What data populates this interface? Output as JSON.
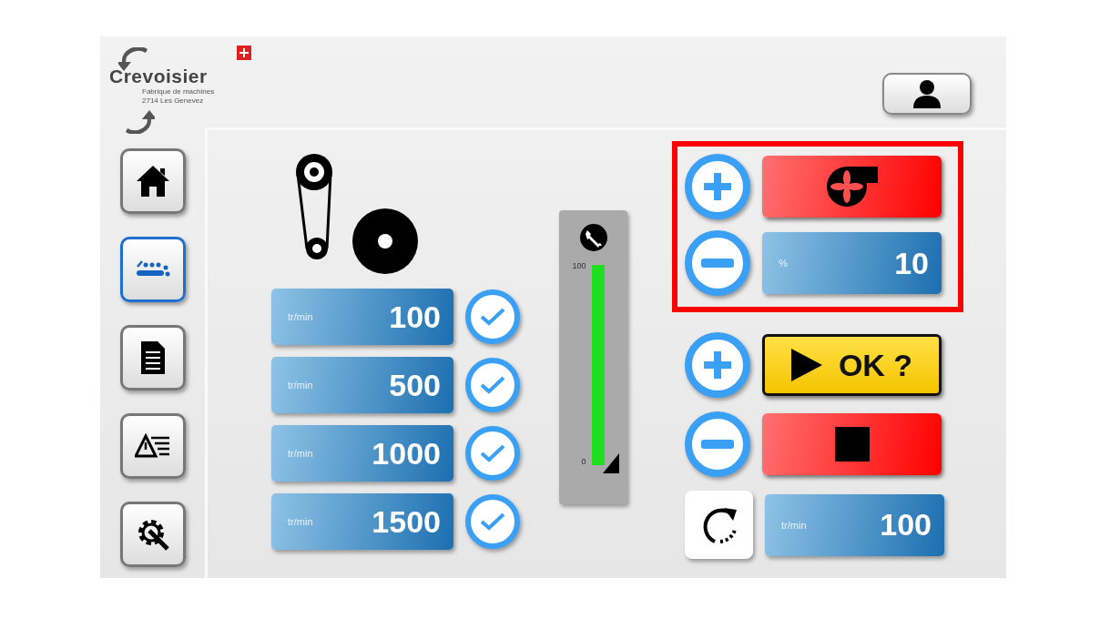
{
  "logo": {
    "name": "Crevoisier",
    "subtitle": [
      "Fabrique de machines",
      "2714 Les Genevez"
    ]
  },
  "sidebar": {
    "items": [
      {
        "kind": "home",
        "selected": false
      },
      {
        "kind": "conveyor",
        "selected": true
      },
      {
        "kind": "document",
        "selected": false
      },
      {
        "kind": "alarms",
        "selected": false
      },
      {
        "kind": "settings",
        "selected": false
      }
    ]
  },
  "speed_presets": [
    {
      "unit": "tr/min",
      "value": "100",
      "checked": true
    },
    {
      "unit": "tr/min",
      "value": "500",
      "checked": true
    },
    {
      "unit": "tr/min",
      "value": "1000",
      "checked": true
    },
    {
      "unit": "tr/min",
      "value": "1500",
      "checked": true
    }
  ],
  "gauge": {
    "max_label": "100",
    "min_label": "0",
    "level": 1
  },
  "fan_panel": {
    "highlighted": true,
    "on": false,
    "unit": "%",
    "value": "10"
  },
  "run_panel": {
    "start_label": "OK ?",
    "unit": "tr/min",
    "value": "100"
  }
}
